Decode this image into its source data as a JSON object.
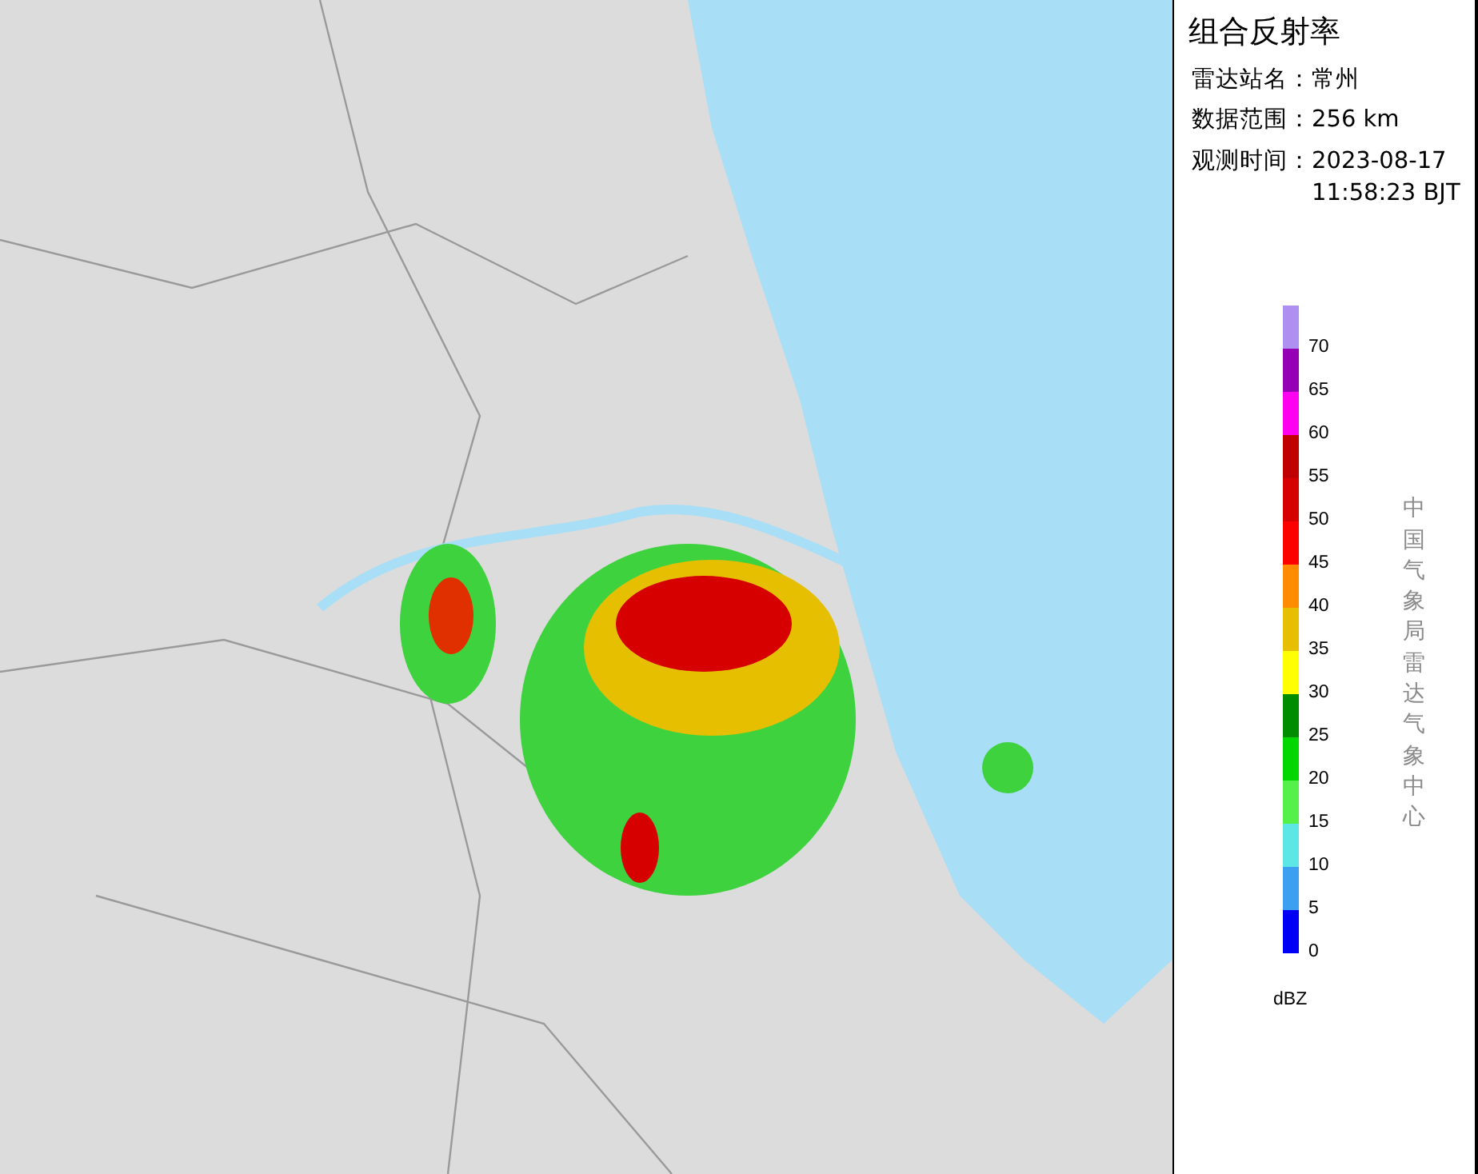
{
  "panel": {
    "title": "组合反射率",
    "info": [
      {
        "label": "雷达站名：",
        "value": "常州"
      },
      {
        "label": "数据范围：",
        "value": "256 km"
      },
      {
        "label": "观测时间：",
        "value": "2023-08-17 11:58:23 BJT"
      }
    ],
    "legend": {
      "swatches": [
        {
          "color": "#ad90f0"
        },
        {
          "color": "#9600b4"
        },
        {
          "color": "#ff00f0"
        },
        {
          "color": "#c00000"
        },
        {
          "color": "#d60000"
        },
        {
          "color": "#ff0000"
        },
        {
          "color": "#ff8c00"
        },
        {
          "color": "#e6c000"
        },
        {
          "color": "#ffff00"
        },
        {
          "color": "#008c00"
        },
        {
          "color": "#00d600"
        },
        {
          "color": "#56f04a"
        },
        {
          "color": "#5ce6e6"
        },
        {
          "color": "#3c9ff0"
        },
        {
          "color": "#0000f6"
        }
      ],
      "labels": [
        "70",
        "65",
        "60",
        "55",
        "50",
        "45",
        "40",
        "35",
        "30",
        "25",
        "20",
        "15",
        "10",
        "5",
        "0"
      ],
      "unit": "dBZ"
    },
    "credit": "中国气象局雷达气象中心"
  }
}
